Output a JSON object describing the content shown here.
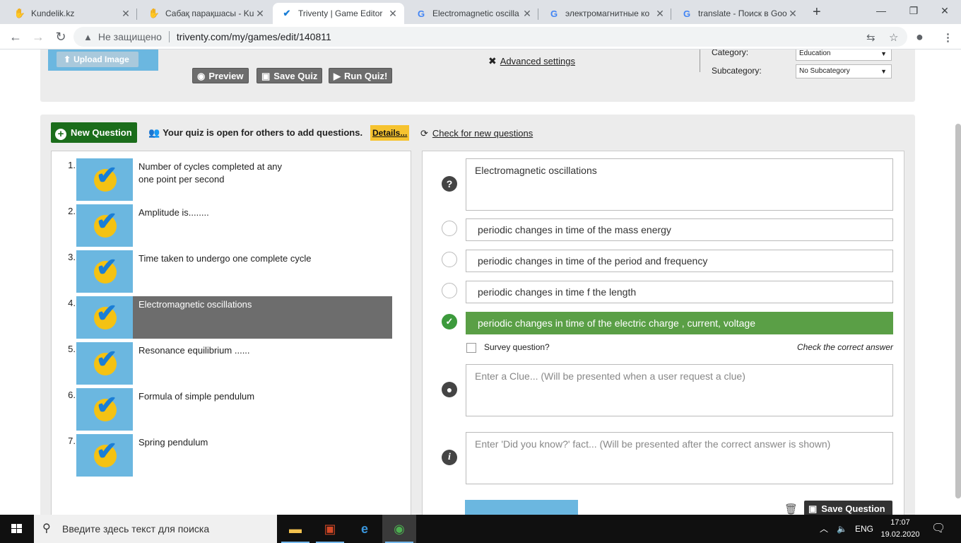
{
  "browser": {
    "tabs": [
      {
        "title": "Kundelik.kz",
        "icon": "hand-icon"
      },
      {
        "title": "Сабақ парақшасы - Ku",
        "icon": "hand-icon"
      },
      {
        "title": "Triventy | Game Editor",
        "icon": "check-icon",
        "active": true
      },
      {
        "title": "Electromagnetic oscilla",
        "icon": "google-icon"
      },
      {
        "title": "электромагнитные ко",
        "icon": "google-icon"
      },
      {
        "title": "translate - Поиск в Goo",
        "icon": "google-icon"
      }
    ],
    "security_label": "Не защищено",
    "url": "triventy.com/my/games/edit/140811"
  },
  "header": {
    "upload_image": "Upload Image",
    "preview": "Preview",
    "save_quiz": "Save Quiz",
    "run_quiz": "Run Quiz!",
    "advanced_settings": "Advanced settings",
    "category_label": "Category:",
    "category_value": "Education",
    "subcategory_label": "Subcategory:",
    "subcategory_value": "No Subcategory"
  },
  "toolbar": {
    "new_question": "New Question",
    "open_message": "Your quiz is open for others to add questions.",
    "details": "Details...",
    "check_new": "Check for new questions"
  },
  "questions": [
    {
      "num": "1.",
      "text": "Number of cycles completed at any one point per second"
    },
    {
      "num": "2.",
      "text": "Amplitude is........"
    },
    {
      "num": "3.",
      "text": "Time taken to undergo one complete cycle"
    },
    {
      "num": "4.",
      "text": "Electromagnetic oscillations",
      "selected": true
    },
    {
      "num": "5.",
      "text": "Resonance equilibrium ......"
    },
    {
      "num": "6.",
      "text": "Formula of simple pendulum"
    },
    {
      "num": "7.",
      "text": "Spring pendulum"
    }
  ],
  "editor": {
    "question_text": "Electromagnetic oscillations",
    "answers": [
      {
        "text": "periodic changes in time of the mass energy",
        "correct": false
      },
      {
        "text": "periodic changes in time of the period and frequency",
        "correct": false
      },
      {
        "text": "periodic changes in time f the length",
        "correct": false
      },
      {
        "text": "periodic changes in time of the electric charge , current, voltage",
        "correct": true
      }
    ],
    "survey_label": "Survey question?",
    "hint": "Check the correct answer",
    "clue_placeholder": "Enter a Clue... (Will be presented when a user request a clue)",
    "fact_placeholder": "Enter 'Did you know?' fact... (Will be presented after the correct answer is shown)",
    "save_question": "Save Question"
  },
  "taskbar": {
    "search_placeholder": "Введите здесь текст для поиска",
    "lang": "ENG",
    "time": "17:07",
    "date": "19.02.2020"
  },
  "colors": {
    "accent_green": "#1b6d1b",
    "correct_green": "#5a9f46",
    "thumb_blue": "#6bb7e0",
    "details_yellow": "#f6c32f"
  }
}
